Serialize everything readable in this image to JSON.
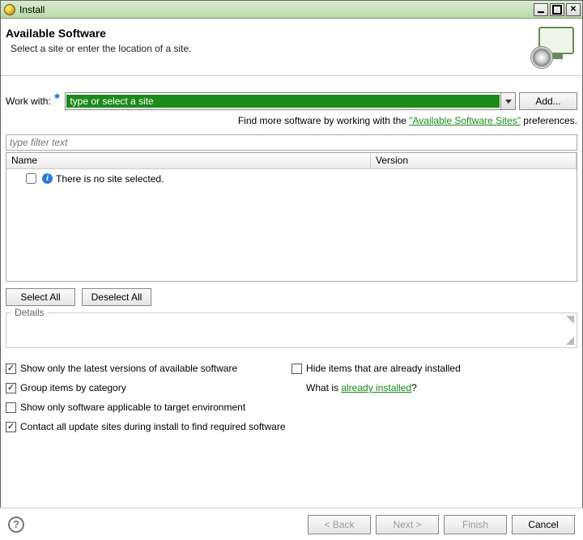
{
  "window": {
    "title": "Install"
  },
  "header": {
    "title": "Available Software",
    "subtitle": "Select a site or enter the location of a site."
  },
  "workwith": {
    "label": "Work with:",
    "value": "type or select a site",
    "add_label": "Add..."
  },
  "findmore": {
    "prefix": "Find more software by working with the ",
    "link": "\"Available Software Sites\"",
    "suffix": " preferences."
  },
  "filter": {
    "placeholder": "type filter text"
  },
  "table": {
    "columns": {
      "name": "Name",
      "version": "Version"
    },
    "empty_row": {
      "checked": false,
      "message": "There is no site selected."
    }
  },
  "buttons": {
    "select_all": "Select All",
    "deselect_all": "Deselect All"
  },
  "details": {
    "legend": "Details"
  },
  "options": {
    "latest": {
      "checked": true,
      "label": "Show only the latest versions of available software"
    },
    "group": {
      "checked": true,
      "label": "Group items by category"
    },
    "target_env": {
      "checked": false,
      "label": "Show only software applicable to target environment"
    },
    "contact_sites": {
      "checked": true,
      "label": "Contact all update sites during install to find required software"
    },
    "hide_installed": {
      "checked": false,
      "label": "Hide items that are already installed"
    },
    "whatis_prefix": "What is ",
    "whatis_link": "already installed",
    "whatis_suffix": "?"
  },
  "footer": {
    "back": "< Back",
    "next": "Next >",
    "finish": "Finish",
    "cancel": "Cancel"
  }
}
